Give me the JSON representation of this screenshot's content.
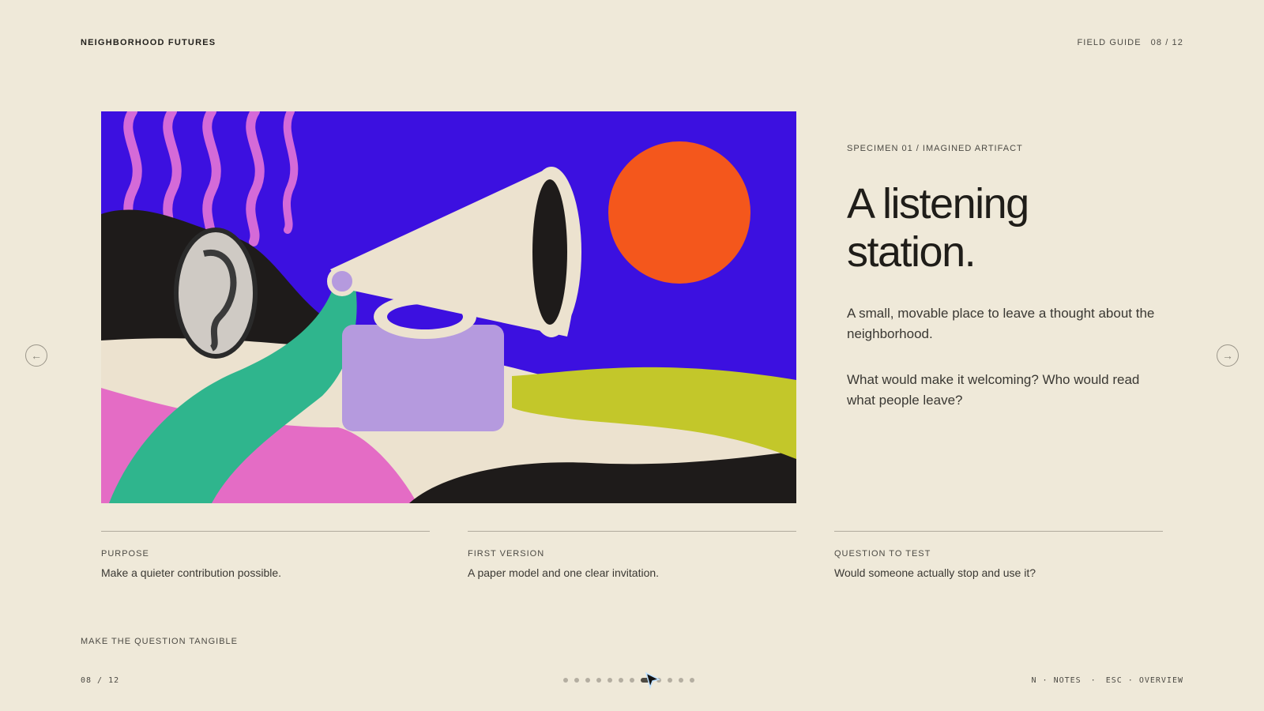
{
  "header": {
    "brand": "NEIGHBORHOOD FUTURES",
    "section": "FIELD GUIDE",
    "progress": "08 / 12"
  },
  "nav": {
    "prev_icon": "arrow-left-icon",
    "next_icon": "arrow-right-icon"
  },
  "specimen": {
    "eyebrow": "SPECIMEN 01 / IMAGINED ARTIFACT",
    "title_line1": "A listening",
    "title_line2": "station.",
    "paragraph1": "A small, movable place to leave a thought about the neighborhood.",
    "paragraph2": "What would make it welcoming? Who would read what people leave?"
  },
  "columns": [
    {
      "label": "PURPOSE",
      "text": "Make a quieter contribution possible."
    },
    {
      "label": "FIRST VERSION",
      "text": "A paper model and one clear invitation."
    },
    {
      "label": "QUESTION TO TEST",
      "text": "Would someone actually stop and use it?"
    }
  ],
  "footer": {
    "kicker": "MAKE THE QUESTION TANGIBLE",
    "counter": "08 / 12",
    "slide_count": 12,
    "current_slide": 8,
    "shortcut_notes": "N · NOTES",
    "shortcut_separator": "·",
    "shortcut_overview": "ESC · OVERVIEW"
  },
  "colors": {
    "background": "#efe9d9",
    "text": "#23211d",
    "art_sky": "#3c10e0",
    "sun": "#f4571c",
    "teal": "#2fb58d",
    "pink": "#e46cc5",
    "lime": "#c3c72a",
    "lavender": "#b59ade"
  }
}
